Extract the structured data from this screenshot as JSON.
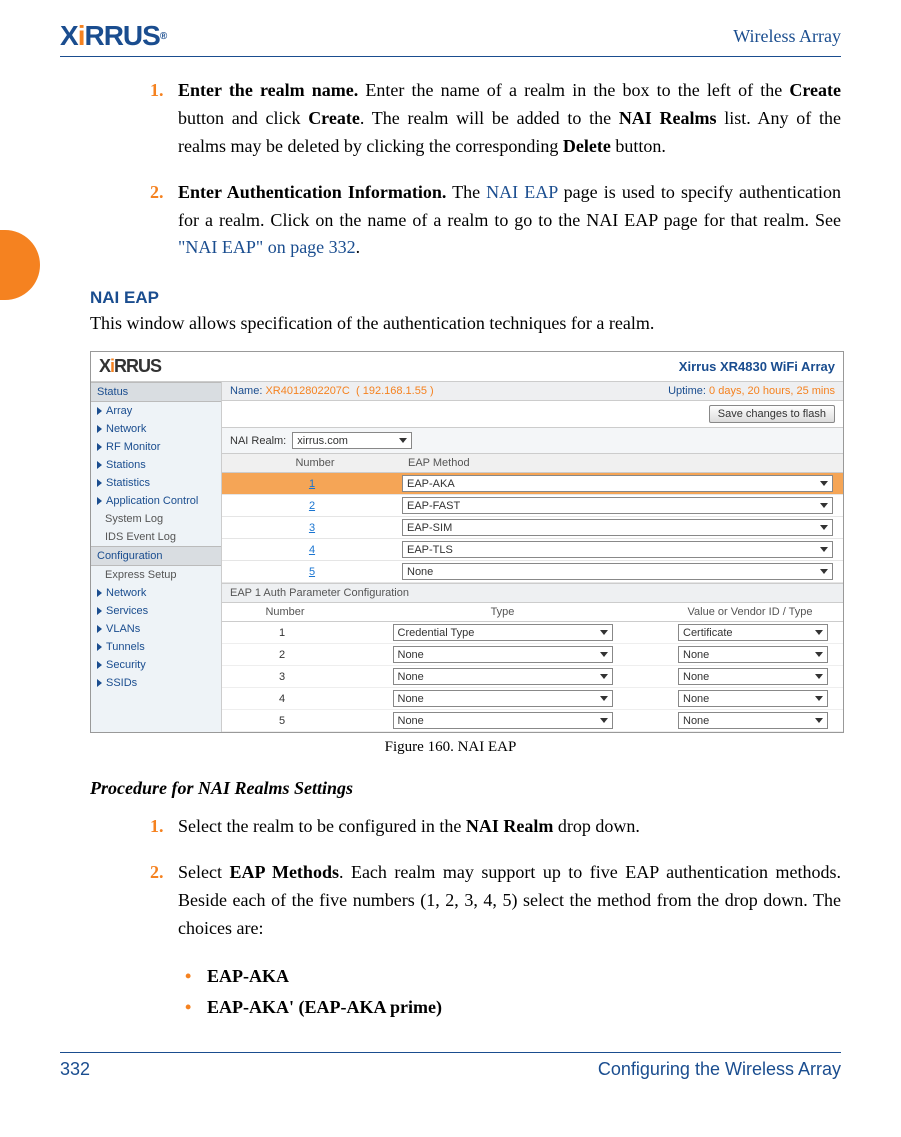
{
  "header": {
    "right": "Wireless Array"
  },
  "steps_top": [
    {
      "num": "1.",
      "bold": "Enter the realm name.",
      "rest": " Enter the name of a realm in the box to the left of the ",
      "b2": "Create",
      "r2": " button and click ",
      "b3": "Create",
      "r3": ". The realm will be added to the ",
      "b4": "NAI Realms",
      "r4": " list. Any of the realms may be deleted by clicking the corresponding ",
      "b5": "Delete",
      "r5": " button."
    },
    {
      "num": "2.",
      "bold": "Enter Authentication Information.",
      "rest": " The ",
      "link1": "NAI EAP",
      "r2": " page is used to specify authentication for a realm. Click on the name of a realm to go to the NAI EAP page for that realm. See ",
      "link2": "\"NAI EAP\" on page 332",
      "r3": "."
    }
  ],
  "section": {
    "title": "NAI EAP",
    "para": "This window allows specification of the authentication techniques for a realm."
  },
  "caption": "Figure 160. NAI EAP",
  "proc_title": "Procedure for NAI Realms Settings",
  "steps_bottom": [
    {
      "num": "1.",
      "pre": "Select the realm to be configured in the ",
      "b": "NAI Realm",
      "post": " drop down."
    },
    {
      "num": "2.",
      "pre": "Select ",
      "b": "EAP Methods",
      "post": ". Each realm may support up to five EAP authentication methods. Beside each of the five numbers (1, 2, 3, 4, 5) select the method from the drop down. The choices are:"
    }
  ],
  "bullets": [
    "EAP-AKA",
    "EAP-AKA' (EAP-AKA prime)"
  ],
  "footer": {
    "left": "332",
    "right": "Configuring the Wireless Array"
  },
  "shot": {
    "title": "Xirrus XR4830 WiFi Array",
    "name_label": "Name:",
    "name": "XR4012802207C",
    "ip": "( 192.168.1.55 )",
    "uptime_label": "Uptime:",
    "uptime": "0 days, 20 hours, 25 mins",
    "save_btn": "Save changes to flash",
    "nai_label": "NAI Realm:",
    "nai_value": "xirrus.com",
    "sidebar": {
      "status_title": "Status",
      "status_items": [
        "Array",
        "Network",
        "RF Monitor",
        "Stations",
        "Statistics",
        "Application Control"
      ],
      "status_plain": [
        "System Log",
        "IDS Event Log"
      ],
      "config_title": "Configuration",
      "config_plain_first": "Express Setup",
      "config_items": [
        "Network",
        "Services",
        "VLANs",
        "Tunnels",
        "Security",
        "SSIDs"
      ]
    },
    "eap_head": {
      "c1": "Number",
      "c2": "EAP Method"
    },
    "eap_rows": [
      {
        "n": "1",
        "v": "EAP-AKA",
        "hi": true
      },
      {
        "n": "2",
        "v": "EAP-FAST"
      },
      {
        "n": "3",
        "v": "EAP-SIM"
      },
      {
        "n": "4",
        "v": "EAP-TLS"
      },
      {
        "n": "5",
        "v": "None"
      }
    ],
    "param_title": "EAP 1 Auth Parameter Configuration",
    "param_head": {
      "p1": "Number",
      "p2": "Type",
      "p3": "Value or Vendor ID / Type"
    },
    "param_rows": [
      {
        "n": "1",
        "t": "Credential Type",
        "v": "Certificate"
      },
      {
        "n": "2",
        "t": "None",
        "v": "None"
      },
      {
        "n": "3",
        "t": "None",
        "v": "None"
      },
      {
        "n": "4",
        "t": "None",
        "v": "None"
      },
      {
        "n": "5",
        "t": "None",
        "v": "None"
      }
    ]
  }
}
